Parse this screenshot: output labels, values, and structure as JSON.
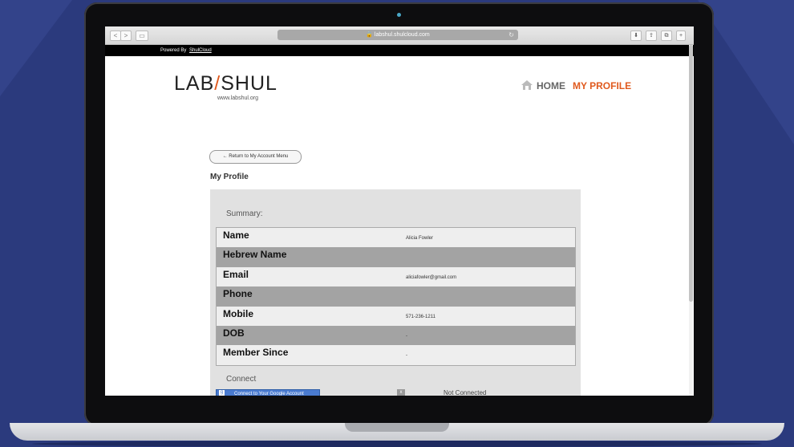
{
  "browser": {
    "url": "labshul.shulcloud.com",
    "nav_back": "<",
    "nav_forward": ">",
    "reload": "↻"
  },
  "powered_bar": {
    "label": "Powered By",
    "link": "ShulCloud"
  },
  "site": {
    "logo_left": "LAB",
    "logo_slash": "/",
    "logo_right": "SHUL",
    "logo_subtitle": "www.labshul.org",
    "nav": {
      "home": "HOME",
      "my_profile": "MY PROFILE"
    },
    "accent_color": "#e05a1e"
  },
  "page": {
    "return_button": "← Return to My Account Menu",
    "title": "My Profile",
    "summary_label": "Summary:",
    "summary_rows": [
      {
        "key": "Name",
        "value": "Alicia Fowler"
      },
      {
        "key": "Hebrew Name",
        "value": ""
      },
      {
        "key": "Email",
        "value": "aliciafowler@gmail.com"
      },
      {
        "key": "Phone",
        "value": ""
      },
      {
        "key": "Mobile",
        "value": "571-236-1211"
      },
      {
        "key": "DOB",
        "value": "-"
      },
      {
        "key": "Member Since",
        "value": "-"
      }
    ],
    "connect_label": "Connect",
    "google_button": "Connect to Your Google Account",
    "disconnect_glyph": "x",
    "connection_status": "Not Connected"
  }
}
